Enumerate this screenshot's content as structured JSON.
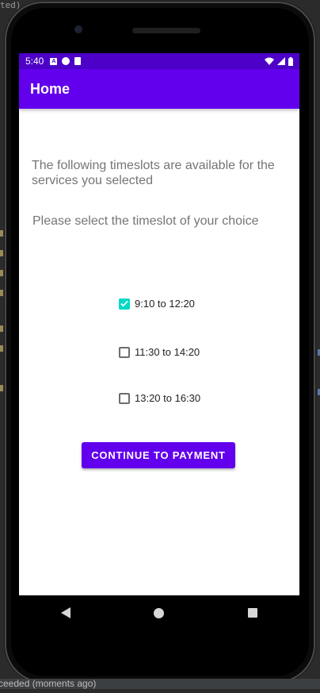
{
  "ide": {
    "top_fragment": "ted)",
    "bottom_status": "ceeded (moments ago)"
  },
  "status_bar": {
    "time": "5:40",
    "icons": [
      "a-box-icon",
      "circle-p-icon",
      "sd-card-icon",
      "wifi-icon",
      "signal-icon",
      "battery-icon"
    ]
  },
  "app_bar": {
    "title": "Home"
  },
  "main": {
    "intro_text": "The following timeslots are available for the services you selected",
    "select_prompt": "Please select the timeslot of your choice",
    "timeslots": [
      {
        "label": "9:10 to 12:20",
        "checked": true
      },
      {
        "label": "11:30 to 14:20",
        "checked": false
      },
      {
        "label": "13:20 to 16:30",
        "checked": false
      }
    ],
    "continue_button": "CONTINUE TO PAYMENT"
  },
  "colors": {
    "app_bar": "#6200ee",
    "status_bar": "#4c00c8",
    "checkbox_accent": "#03dac5"
  }
}
